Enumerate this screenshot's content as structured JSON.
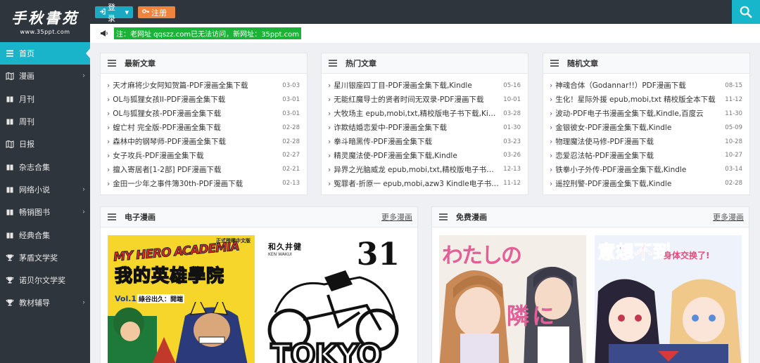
{
  "logo": {
    "brand": "手秋書苑",
    "url": "www.35ppt.com"
  },
  "header": {
    "login_label": "登录",
    "register_label": "注册"
  },
  "notice": {
    "text": "注：老网址 qqszz.com已无法访问，新网址：35ppt.com"
  },
  "sidebar": {
    "items": [
      {
        "label": "首页",
        "icon": "home-icon",
        "chev": false
      },
      {
        "label": "漫画",
        "icon": "map-icon",
        "chev": true
      },
      {
        "label": "月刊",
        "icon": "book-icon",
        "chev": false
      },
      {
        "label": "周刊",
        "icon": "book-icon",
        "chev": false
      },
      {
        "label": "日报",
        "icon": "map-icon",
        "chev": false
      },
      {
        "label": "杂志合集",
        "icon": "book-icon",
        "chev": false
      },
      {
        "label": "网络小说",
        "icon": "book-icon",
        "chev": true
      },
      {
        "label": "畅销图书",
        "icon": "book-icon",
        "chev": true
      },
      {
        "label": "经典合集",
        "icon": "book-icon",
        "chev": false
      },
      {
        "label": "茅盾文学奖",
        "icon": "trophy-icon",
        "chev": false
      },
      {
        "label": "诺贝尔文学奖",
        "icon": "trophy-icon",
        "chev": false
      },
      {
        "label": "教材辅导",
        "icon": "trophy-icon",
        "chev": true
      }
    ]
  },
  "panels": {
    "latest": {
      "title": "最新文章",
      "items": [
        {
          "t": "天才麻将少女阿知贺篇-PDF漫画全集下载",
          "d": "03-03"
        },
        {
          "t": "OL与狐狸女孩II-PDF漫画全集下载",
          "d": "03-01"
        },
        {
          "t": "OL与狐狸女孩-PDF漫画全集下载",
          "d": "03-01"
        },
        {
          "t": "蝗亡村 完全版-PDF漫画全集下载",
          "d": "02-28"
        },
        {
          "t": "森林中的钢琴师-PDF漫画全集下载",
          "d": "02-28"
        },
        {
          "t": "女子攻兵-PDF漫画全集下载",
          "d": "02-27"
        },
        {
          "t": "擅入寄居者[1-2部] PDF漫画下载",
          "d": "02-21"
        },
        {
          "t": "金田一少年之事件簿30th-PDF漫画下载",
          "d": "02-13"
        }
      ]
    },
    "hot": {
      "title": "热门文章",
      "items": [
        {
          "t": "星川银座四丁目-PDF漫画全集下载,Kindle",
          "d": "05-16"
        },
        {
          "t": "无能红魔导士的贤者时间无双录-PDF漫画下载",
          "d": "10-01"
        },
        {
          "t": "大牧场主 epub,mobi,txt,精校版电子书下载,Kindle",
          "d": "03-28"
        },
        {
          "t": "诈欺结婚恋爱中-PDF漫画全集下载",
          "d": "01-30"
        },
        {
          "t": "拳斗暗黑传-PDF漫画全集下载",
          "d": "03-23"
        },
        {
          "t": "精灵魔法使-PDF漫画全集下载,Kindle",
          "d": "03-26"
        },
        {
          "t": "异界之光脑威龙 epub,mobi,txt,精校版电子书下载",
          "d": "12-13"
        },
        {
          "t": "冤罪者-折原一 epub,mobi,azw3 Kindle电子书下载",
          "d": "11-12"
        }
      ]
    },
    "random": {
      "title": "随机文章",
      "items": [
        {
          "t": "神魂合体（Godannar!!）PDF漫画下载",
          "d": "08-15"
        },
        {
          "t": "生化！星际外援 epub,mobi,txt 精校版全本下载",
          "d": "11-12"
        },
        {
          "t": "波动-PDF电子书漫画全集下载,Kindle,百度云",
          "d": "11-30"
        },
        {
          "t": "金银彼女-PDF漫画全集下载,Kindle",
          "d": "05-09"
        },
        {
          "t": "物理魔法使马修-PDF漫画下载",
          "d": "10-28"
        },
        {
          "t": "恋爱忍法帖-PDF漫画全集下载",
          "d": "10-27"
        },
        {
          "t": "铁拳小子外传-PDF漫画全集下载,Kindle",
          "d": "03-14"
        },
        {
          "t": "遥控刑警-PDF漫画全集下载,Kindle",
          "d": "02-28"
        }
      ]
    },
    "ebooks": {
      "title": "电子漫画",
      "more": "更多漫画"
    },
    "free": {
      "title": "免费漫画",
      "more": "更多漫画"
    }
  },
  "covers": {
    "mha": {
      "badge": "正式授權中文版",
      "logo": "MY HERO ACADEMIA",
      "title": "我的英雄學院",
      "vol": "Vol.1",
      "sub": "綠谷出久：開端"
    },
    "tokyo": {
      "author": "和久井健",
      "author_en": "KEN WAKUI",
      "number": "31",
      "title": "TOKYO"
    },
    "watashi": {
      "title": "わたしの",
      "title2": "隣に"
    },
    "isou": {
      "title": "意想不到",
      "title2": "身体交换了!"
    }
  },
  "colors": {
    "sidebar": "#2f353d",
    "accent": "#1ab4ca",
    "register": "#f0843e",
    "notice": "#1ab338"
  }
}
